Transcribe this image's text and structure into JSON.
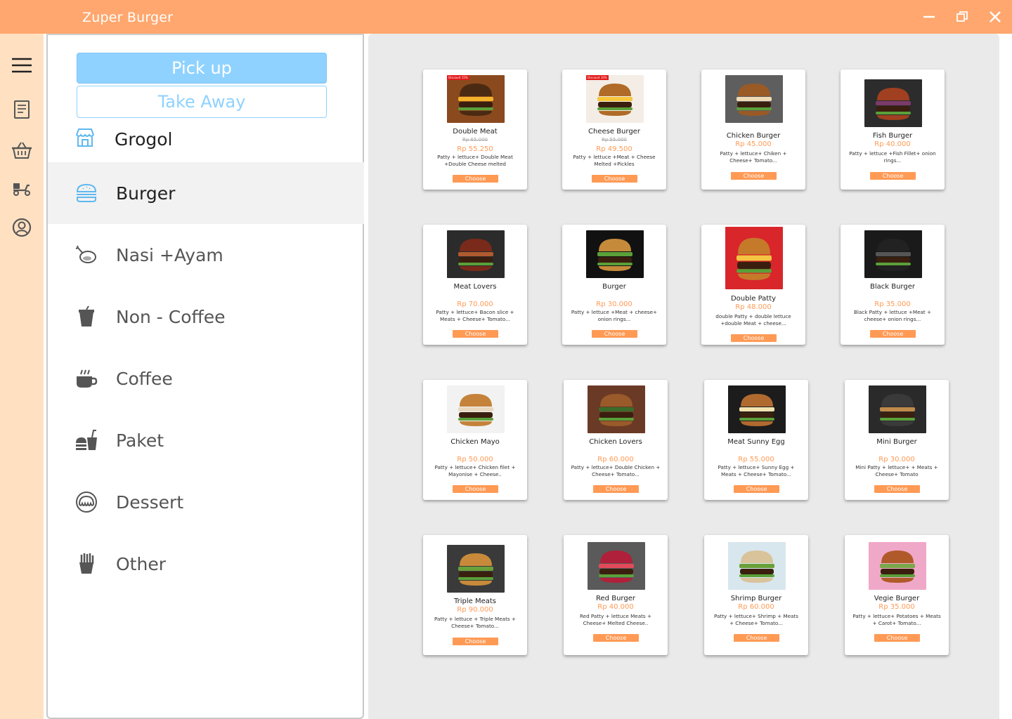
{
  "app": {
    "title": "Zuper Burger"
  },
  "colors": {
    "titlebar": "#FFA76E",
    "rail": "#FFE1C2",
    "accent_blue": "#8FD2FF",
    "accent_orange": "#FF9A55"
  },
  "rail_icons": [
    "menu-icon",
    "receipt-icon",
    "basket-icon",
    "delivery-scooter-icon",
    "user-icon"
  ],
  "order_type": {
    "pickup": "Pick up",
    "takeaway": "Take Away"
  },
  "store": {
    "name": "Grogol",
    "icon": "store-icon"
  },
  "categories": [
    {
      "label": "Burger",
      "icon": "burger-icon",
      "active": true
    },
    {
      "label": "Nasi +Ayam",
      "icon": "chicken-leg-icon",
      "active": false
    },
    {
      "label": "Non - Coffee",
      "icon": "cup-icon",
      "active": false
    },
    {
      "label": "Coffee",
      "icon": "coffee-icon",
      "active": false
    },
    {
      "label": "Paket",
      "icon": "combo-meal-icon",
      "active": false
    },
    {
      "label": "Dessert",
      "icon": "dessert-icon",
      "active": false
    },
    {
      "label": "Other",
      "icon": "fries-icon",
      "active": false
    }
  ],
  "products": [
    {
      "name": "Double Meat",
      "badge": "Discount 15%",
      "old_price": "Rp 65.000",
      "price": "Rp 55.250",
      "desc": "Patty + lettuce+ Double Meat +Double Cheese melted",
      "button": "Choose"
    },
    {
      "name": "Cheese Burger",
      "badge": "Discount 10%",
      "old_price": "Rp 55.000",
      "price": "Rp 49.500",
      "desc": "Patty + lettuce +Meat + Cheese Melted +Pickles",
      "button": "Choose"
    },
    {
      "name": "Chicken Burger",
      "price": "Rp 45.000",
      "desc": "Patty + lettuce+ Chiken + Cheese+ Tomato...",
      "button": "Choose"
    },
    {
      "name": "Fish Burger",
      "price": "Rp 40.000",
      "desc": "Patty + lettuce +Fish Fillet+ onion rings...",
      "button": "Choose"
    },
    {
      "name": "Meat Lovers",
      "price": "Rp 70.000",
      "desc": "Patty + lettuce+ Bacon slice + Meats + Cheese+ Tomato...",
      "button": "Choose"
    },
    {
      "name": "Burger",
      "price": "Rp 30.000",
      "desc": "Patty + lettuce +Meat + cheese+ onion rings...",
      "button": "Choose"
    },
    {
      "name": "Double Patty",
      "price": "Rp 48.000",
      "desc": "double Patty + double lettuce +double Meat + cheese...",
      "button": "Choose"
    },
    {
      "name": "Black Burger",
      "price": "Rp 35.000",
      "desc": "Black Patty + lettuce +Meat + cheese+ onion rings...",
      "button": "Choose"
    },
    {
      "name": "Chicken Mayo",
      "price": "Rp 50.000",
      "desc": "Patty + lettuce+ Chicken filet + Mayonise + Cheese..",
      "button": "Choose"
    },
    {
      "name": "Chicken Lovers",
      "price": "Rp 60.000",
      "desc": "Patty + lettuce+ Double Chicken + Cheese+ Tomato...",
      "button": "Choose"
    },
    {
      "name": "Meat Sunny Egg",
      "price": "Rp 55.000",
      "desc": "Patty + lettuce+ Sunny Egg + Meats + Cheese+ Tomato...",
      "button": "Choose"
    },
    {
      "name": "Mini Burger",
      "price": "Rp 30.000",
      "desc": "Mini Patty + lettuce+ + Meats + Cheese+ Tomato",
      "button": "Choose"
    },
    {
      "name": "Triple Meats",
      "price": "Rp 90.000",
      "desc": "Patty + lettuce + Triple Meats + Cheese+ Tomato...",
      "button": "Choose"
    },
    {
      "name": "Red Burger",
      "price": "Rp 40.000",
      "desc": "Red Patty + lettuce Meats + Cheese+ Melted Cheese..",
      "button": "Choose"
    },
    {
      "name": "Shrimp Burger",
      "price": "Rp 60.000",
      "desc": "Patty + lettuce+ Shrimp + Meats + Cheese+ Tomato...",
      "button": "Choose"
    },
    {
      "name": "Vegie Burger",
      "price": "Rp 35.000",
      "desc": "Patty + lettuce+ Potatoes + Meats + Carot+ Tomato...",
      "button": "Choose"
    }
  ]
}
